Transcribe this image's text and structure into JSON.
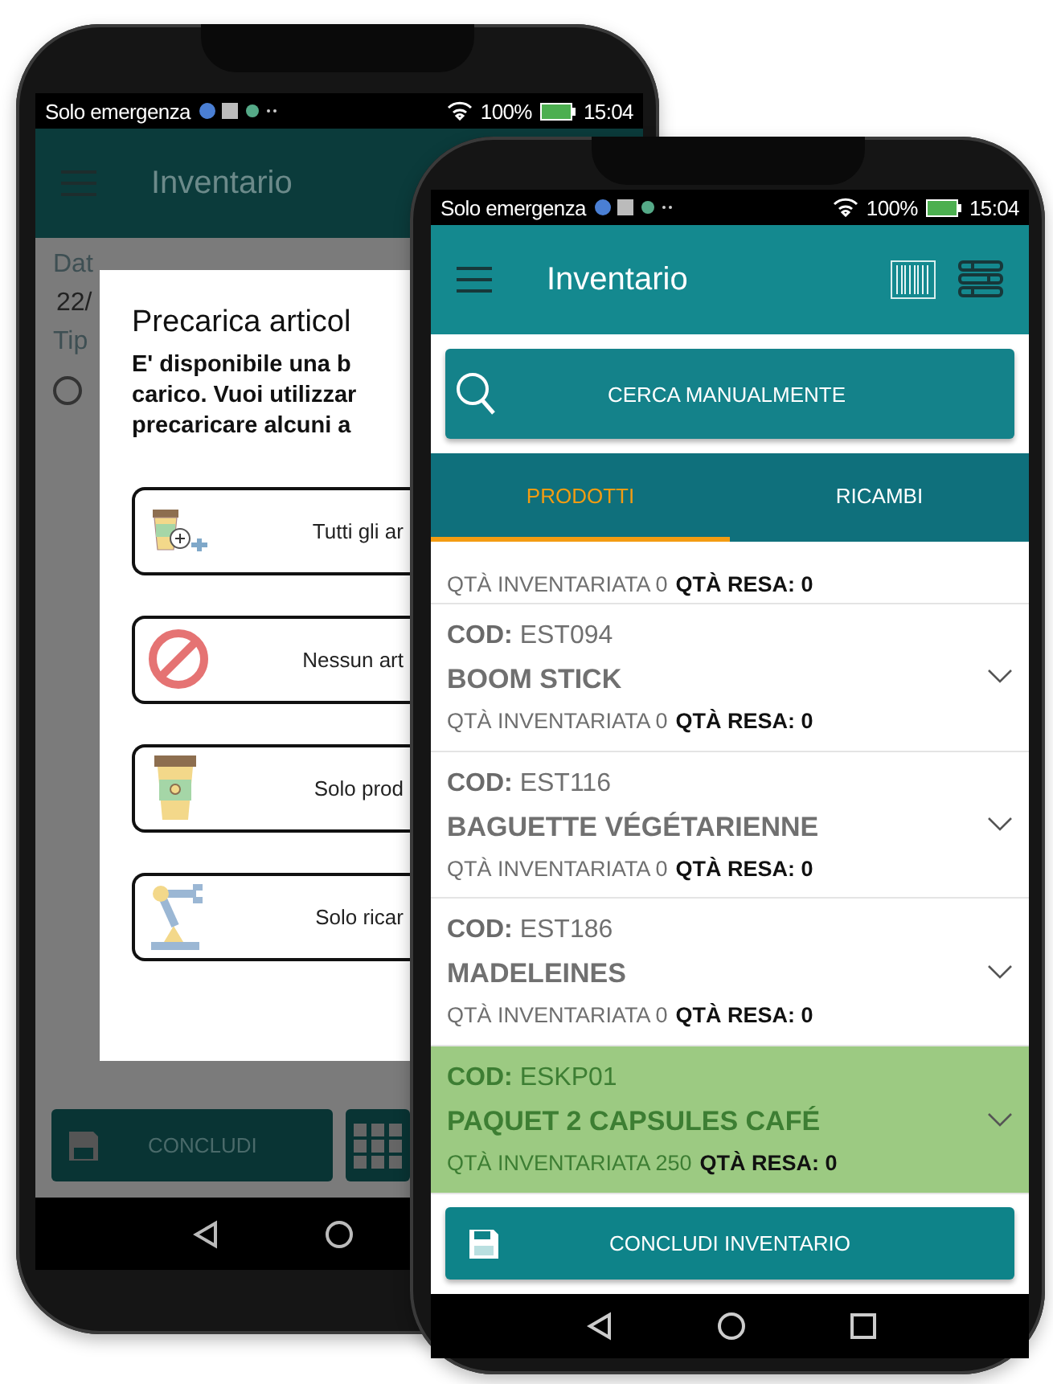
{
  "back_phone": {
    "status_bar": {
      "carrier": "Solo emergenza",
      "battery": "100%",
      "time": "15:04"
    },
    "app_bar": {
      "title": "Inventario"
    },
    "form": {
      "date_label": "Dat",
      "date_value": "22/",
      "type_label": "Tip",
      "radio_selected": false
    },
    "dialog": {
      "title": "Precarica articol",
      "message_lines": [
        "E' disponibile una b",
        "carico. Vuoi utilizzar",
        "precaricare alcuni a"
      ],
      "options": [
        {
          "label": "Tutti gli ar",
          "kind": "all"
        },
        {
          "label": "Nessun art",
          "kind": "none"
        },
        {
          "label": "Solo prod",
          "kind": "products"
        },
        {
          "label": "Solo ricar",
          "kind": "parts"
        }
      ]
    },
    "bottom_button": {
      "label": "CONCLUDI"
    }
  },
  "front_phone": {
    "status_bar": {
      "carrier": "Solo emergenza",
      "battery": "100%",
      "time": "15:04"
    },
    "app_bar": {
      "title": "Inventario"
    },
    "search_button": {
      "label": "CERCA MANUALMENTE"
    },
    "tabs": [
      {
        "label": "PRODOTTI",
        "selected": true
      },
      {
        "label": "RICAMBI",
        "selected": false
      }
    ],
    "items": [
      {
        "qty_label": "QTÀ INVENTARIATA",
        "qty": "0",
        "returned_label": "QTÀ RESA:",
        "returned": "0",
        "highlighted": false
      },
      {
        "code_label": "COD:",
        "code": "EST094",
        "name": "BOOM STICK",
        "qty_label": "QTÀ INVENTARIATA",
        "qty": "0",
        "returned_label": "QTÀ RESA:",
        "returned": "0",
        "highlighted": false
      },
      {
        "code_label": "COD:",
        "code": "EST116",
        "name": "BAGUETTE VÉGÉTARIENNE",
        "qty_label": "QTÀ INVENTARIATA",
        "qty": "0",
        "returned_label": "QTÀ RESA:",
        "returned": "0",
        "highlighted": false
      },
      {
        "code_label": "COD:",
        "code": "EST186",
        "name": "MADELEINES",
        "qty_label": "QTÀ INVENTARIATA",
        "qty": "0",
        "returned_label": "QTÀ RESA:",
        "returned": "0",
        "highlighted": false
      },
      {
        "code_label": "COD:",
        "code": "ESKP01",
        "name": "PAQUET 2 CAPSULES CAFÉ",
        "qty_label": "QTÀ INVENTARIATA",
        "qty": "250",
        "returned_label": "QTÀ RESA:",
        "returned": "0",
        "highlighted": true
      }
    ],
    "finish_button": {
      "label": "CONCLUDI INVENTARIO"
    }
  }
}
